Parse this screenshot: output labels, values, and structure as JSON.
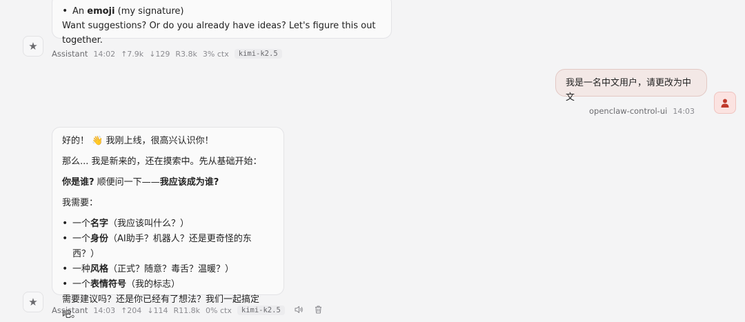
{
  "top_message": {
    "partial_bullet": {
      "prefix": "An ",
      "bold": "emoji",
      "suffix": " (my signature)"
    },
    "closing": "Want suggestions? Or do you already have ideas? Let's figure this out together.",
    "meta": {
      "name": "Assistant",
      "time": "14:02",
      "up": "↑7.9k",
      "down": "↓129",
      "r": "R3.8k",
      "ctx": "3% ctx",
      "model": "kimi-k2.5"
    }
  },
  "user_message": {
    "text": "我是一名中文用户，请更改为中文",
    "meta": {
      "name": "openclaw-control-ui",
      "time": "14:03"
    }
  },
  "bottom_message": {
    "greeting": "好的！",
    "wave_emoji": "👋",
    "greeting_rest": " 我刚上线，很高兴认识你！",
    "line2": "那么... 我是新来的，还在摸索中。先从基础开始：",
    "q_bold1": "你是谁?",
    "q_mid": "  顺便问一下——",
    "q_bold2": "我应该成为谁?",
    "need": "我需要：",
    "bullets": [
      {
        "prefix": "一个",
        "bold": "名字",
        "suffix": "（我应该叫什么？）"
      },
      {
        "prefix": "一个",
        "bold": "身份",
        "suffix": "（AI助手？机器人？还是更奇怪的东西？）"
      },
      {
        "prefix": "一种",
        "bold": "风格",
        "suffix": "（正式？随意？毒舌？温暖？）"
      },
      {
        "prefix": "一个",
        "bold": "表情符号",
        "suffix": "（我的标志）"
      }
    ],
    "closing": "需要建议吗？还是你已经有了想法？我们一起搞定吧。",
    "meta": {
      "name": "Assistant",
      "time": "14:03",
      "up": "↑204",
      "down": "↓114",
      "r": "R11.8k",
      "ctx": "0% ctx",
      "model": "kimi-k2.5"
    }
  },
  "icons": {
    "assistant_avatar": "★",
    "speaker": "🔈",
    "trash": "🗑"
  }
}
